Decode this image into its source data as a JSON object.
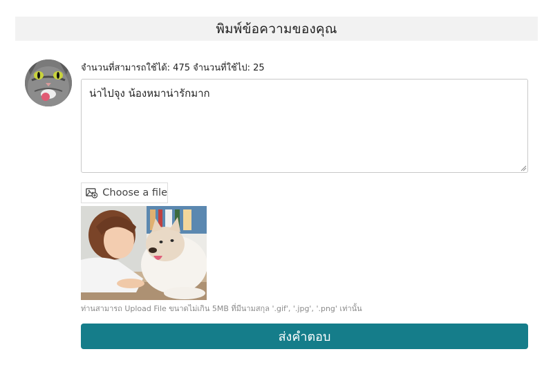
{
  "header": {
    "title": "พิมพ์ข้อความของคุณ"
  },
  "avatar": {
    "icon": "cat-avatar"
  },
  "counter": {
    "text": "จำนวนที่สามารถใช้ได้: 475 จำนวนที่ใช้ไป: 25"
  },
  "message": {
    "value": "น่าไปจุง น้องหมาน่ารักมาก"
  },
  "file_upload": {
    "label": "Choose a file",
    "icon": "image-add-icon"
  },
  "preview": {
    "icon": "girl-with-husky-photo"
  },
  "upload_note": "ท่านสามารถ Upload File ขนาดไม่เกิน 5MB ที่มีนามสกุล '.gif', '.jpg', '.png' เท่านั้น",
  "submit": {
    "label": "ส่งคำตอบ"
  },
  "colors": {
    "accent": "#157d8a",
    "header_bg": "#f2f2f2",
    "note_text": "#8a8a8a"
  }
}
